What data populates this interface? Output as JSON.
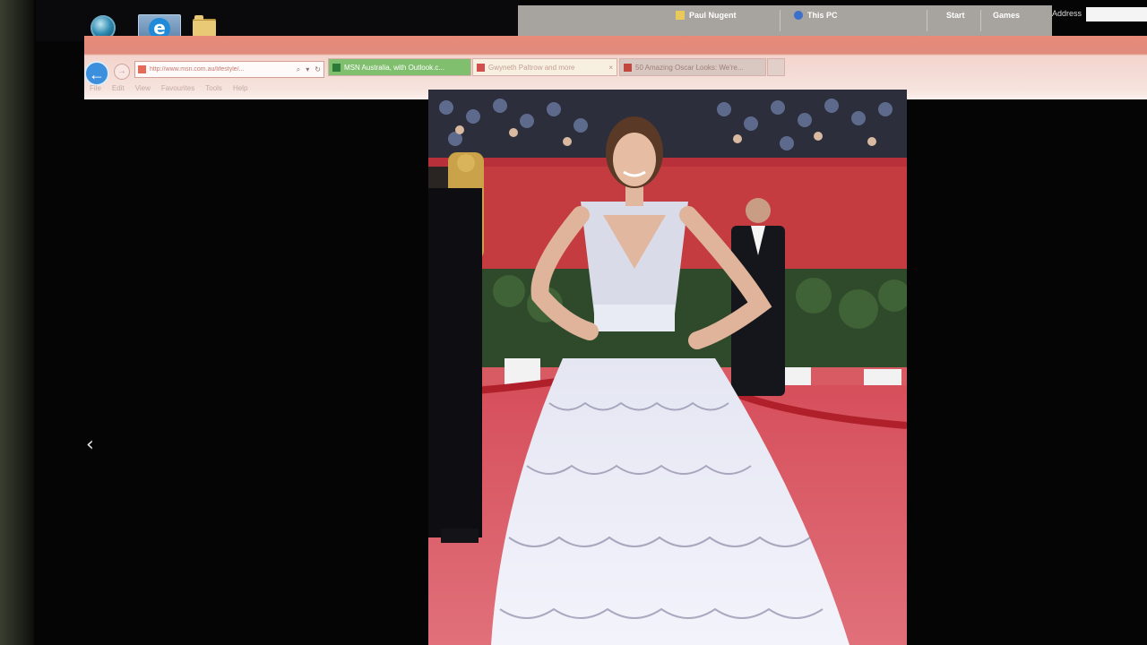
{
  "taskbar": {
    "start_icon": "windows-orb-icon",
    "pinned": [
      {
        "name": "internet-explorer-icon"
      },
      {
        "name": "file-explorer-folder-icon"
      }
    ]
  },
  "titlebar": {
    "user": "Paul Nugent",
    "pc": "This PC",
    "start": "Start",
    "games": "Games",
    "address_label": "Address"
  },
  "browser": {
    "url": "http://www.msn.com.au/lifestyle/...",
    "tabs": [
      {
        "title": "MSN Australia, with Outlook.c...",
        "color": "#7fbf6e"
      },
      {
        "title": "Gwyneth Paltrow and more",
        "color": "#f7efe0"
      },
      {
        "title": "50 Amazing Oscar Looks: We're...",
        "color": "#d9c7c2"
      }
    ],
    "menu": [
      "File",
      "Edit",
      "View",
      "Favourites",
      "Tools",
      "Help"
    ]
  },
  "page": {
    "prev_arrow": "‹"
  },
  "colors": {
    "red_carpet": "#d85a62",
    "ie_accent": "#3b8fdc",
    "titlebar": "#a7a39f"
  }
}
